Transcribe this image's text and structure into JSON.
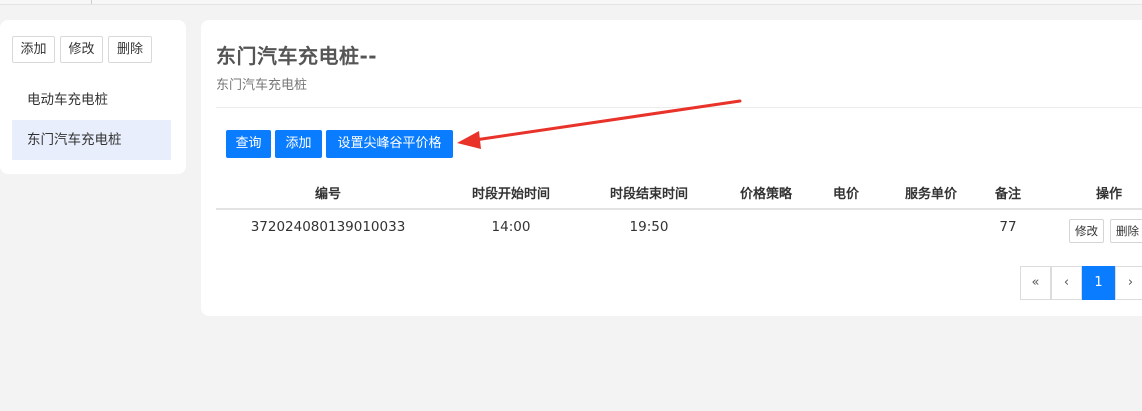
{
  "colors": {
    "primary": "#0a7cff",
    "arrow": "#e8322a",
    "active_item_bg": "#e8eefc",
    "background": "#f3f3f3"
  },
  "sidebar": {
    "buttons": {
      "add": "添加",
      "edit": "修改",
      "delete": "删除"
    },
    "items": [
      {
        "label": "电动车充电桩",
        "active": false
      },
      {
        "label": "东门汽车充电桩",
        "active": true
      }
    ]
  },
  "main": {
    "title": "东门汽车充电桩--",
    "subtitle": "东门汽车充电桩",
    "toolbar": {
      "query": "查询",
      "add": "添加",
      "set_price": "设置尖峰谷平价格"
    },
    "table": {
      "headers": [
        "编号",
        "时段开始时间",
        "时段结束时间",
        "价格策略",
        "电价",
        "服务单价",
        "备注",
        "操作"
      ],
      "rows": [
        {
          "id": "372024080139010033",
          "start": "14:00",
          "end": "19:50",
          "strategy": "",
          "price": "",
          "service_price": "",
          "note": "77",
          "edit": "修改",
          "delete": "删除"
        }
      ]
    },
    "pagination": {
      "first": "«",
      "prev": "‹",
      "current": "1",
      "next": "›"
    }
  }
}
